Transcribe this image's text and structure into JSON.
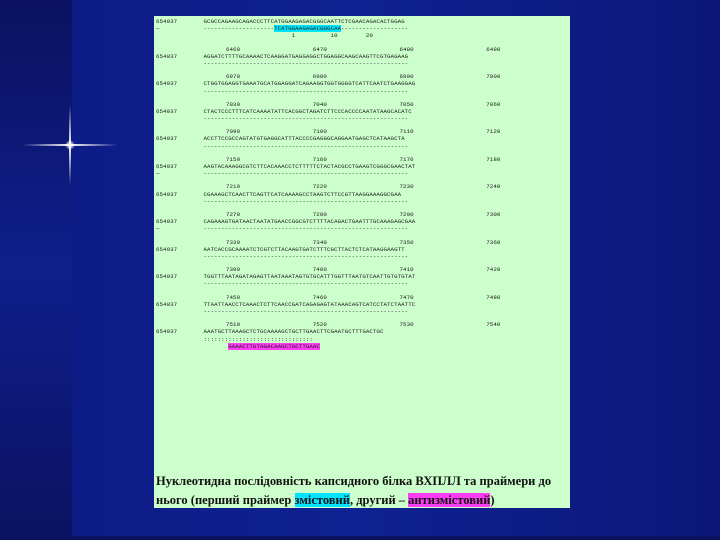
{
  "slide": {
    "accession": "654037",
    "blocks": [
      {
        "nums": "",
        "seq": "GCGCCAGAAGCAGACCCTTCATGGAAGAGACGGGCAATTCTCGAACAGACACTGGAG",
        "dash": "--------------------TCATGGAAGAGACGGGCAA-------------------",
        "primer": "1          10        20"
      },
      {
        "nums": "6460     6470     6480     6490     6500",
        "seq": "AGGATCTTTTGCAAAACTCAAGGATGAGGAGGCTGGAGGCAAGCAAGTTCGTGAGAAG",
        "dash": "----------------------------------------------------------",
        "primer": ""
      },
      {
        "nums": "6970     6980     6990     7000     7010     7020",
        "seq": "CTGGTGGAGGTGAAATGCATGGAGGATCAGAAGGTGGTGGGGTCATTCAATCTGAAGGAG",
        "dash": "----------------------------------------------------------",
        "primer": ""
      },
      {
        "nums": "7030     7040     7050     7060     7070     7080",
        "seq": "CTACTCCCTTTCATCAAAATATTCACGGCTAGATCTTCCCACCCCAATATAAGCACATC",
        "dash": "----------------------------------------------------------",
        "primer": ""
      },
      {
        "nums": "7090     7100     7110     7120     7130     7140",
        "seq": "ACCTTCCGCCAGTATGTGAGGCATTTACCCCGAGGGCAGGAATGAGCTCATAAGCTA",
        "dash": "----------------------------------------------------------",
        "primer": ""
      },
      {
        "nums": "7150     7160     7170     7180     7190     7200",
        "seq": "AAGTACAAAGGCGTCTTCACAAACCTCTTTTTCTACTACGCCTGAAGTCGGGCGAACTAT",
        "dash": "----------------------------------------------------------",
        "primer": ""
      },
      {
        "nums": "7210     7220     7230     7240     7250     7260",
        "seq": "CGAAAGCTCAACTTCAGTTCATCAAAAGCCTAAGTCTTCCGTTAAGGAAAGGCGAA",
        "dash": "----------------------------------------------------------",
        "primer": ""
      },
      {
        "nums": "7270     7280     7290     7300     7310     7320",
        "seq": "CAGAAAGTGATAACTAATATGAACCGGCGTCTTTTACAGACTGAATTTGCAAAGAGCGAA",
        "dash": "----------------------------------------------------------",
        "primer": ""
      },
      {
        "nums": "7330     7340     7350     7360     7370     7380",
        "seq": "AATCACCGCAAAATCTCGTCTTACAAGTGATCTTTCGCTTACTCTCATAAGGAAGTT",
        "dash": "----------------------------------------------------------",
        "primer": ""
      },
      {
        "nums": "7390     7400     7410     7420     7430     7440",
        "seq": "TGGTTTAATAGATAGAGTTAATAAATAGTGTGCATTTGGTTTAATGTCAATTGTGTGTAT",
        "dash": "----------------------------------------------------------",
        "primer": ""
      },
      {
        "nums": "7450     7460     7470     7480     7490     7500",
        "seq": "TTAATTAACCTCAAACTCTTCAACCGATCAGAGAGTATAAACAGTCATCCTATCTAATTC",
        "dash": "----------------------------------------------------------",
        "primer": ""
      },
      {
        "nums": "7510     7520     7530     7540     7550",
        "seq": "AAATGCTTAAAGCTCTGCAAAAGCTGCTTGAACTTCGAATGCTTTGACTGC",
        "dash": ":::::::::::::::::::::::::::::::",
        "primer": "GAAACTTGTAGACAAGCTGCTTGAAC"
      }
    ],
    "caption_part1": "Нуклеотидна послідовність капсидного білка ВХПЛЛ та праймери до нього (перший праймер ",
    "caption_hl1": "змістовий",
    "caption_part2": ", другий – ",
    "caption_hl2": "антизмістовий",
    "caption_part3": ")",
    "colors": {
      "panel": "#ccffcc",
      "highlight_sense": "#00e5ff",
      "highlight_antisense": "#ff3df5"
    }
  }
}
